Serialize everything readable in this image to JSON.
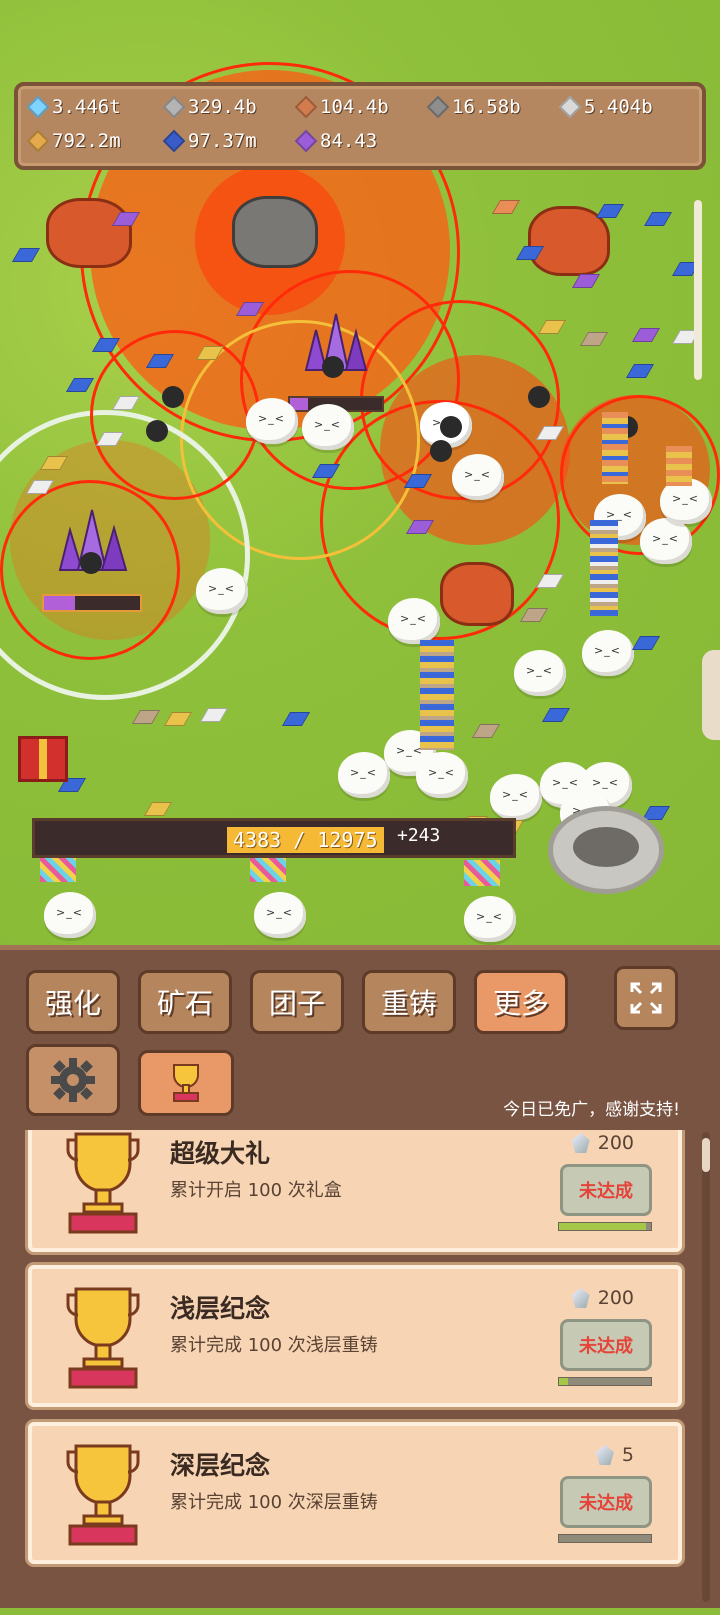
{
  "resources": [
    {
      "value": "3.446t",
      "color": "#7fd3ff"
    },
    {
      "value": "329.4b",
      "color": "#b4b4b4"
    },
    {
      "value": "104.4b",
      "color": "#d27b4c"
    },
    {
      "value": "16.58b",
      "color": "#8e8e8e"
    },
    {
      "value": "5.404b",
      "color": "#d9d9d9"
    },
    {
      "value": "792.2m",
      "color": "#e3a94a"
    },
    {
      "value": "97.37m",
      "color": "#3a5cc8"
    },
    {
      "value": "84.43",
      "color": "#9b5dd8"
    }
  ],
  "progress": {
    "label": "4383 / 12975",
    "gain": "+243",
    "current": 4383,
    "max": 12975
  },
  "tabs": [
    {
      "label": "强化",
      "active": false
    },
    {
      "label": "矿石",
      "active": false
    },
    {
      "label": "团子",
      "active": false
    },
    {
      "label": "重铸",
      "active": false
    },
    {
      "label": "更多",
      "active": true
    }
  ],
  "notice": "今日已免广，感谢支持!",
  "icons": {
    "fullscreen": "expand-icon",
    "settings": "gear-icon",
    "achievements": "trophy-icon"
  },
  "achievements": [
    {
      "title": "超级大礼",
      "desc": "累计开启 100 次礼盒",
      "reward": "200",
      "status": "未达成",
      "progress": 0.95
    },
    {
      "title": "浅层纪念",
      "desc": "累计完成 100 次浅层重铸",
      "reward": "200",
      "status": "未达成",
      "progress": 0.1
    },
    {
      "title": "深层纪念",
      "desc": "累计完成 100 次深层重铸",
      "reward": "5",
      "status": "未达成",
      "progress": 0.0
    }
  ]
}
